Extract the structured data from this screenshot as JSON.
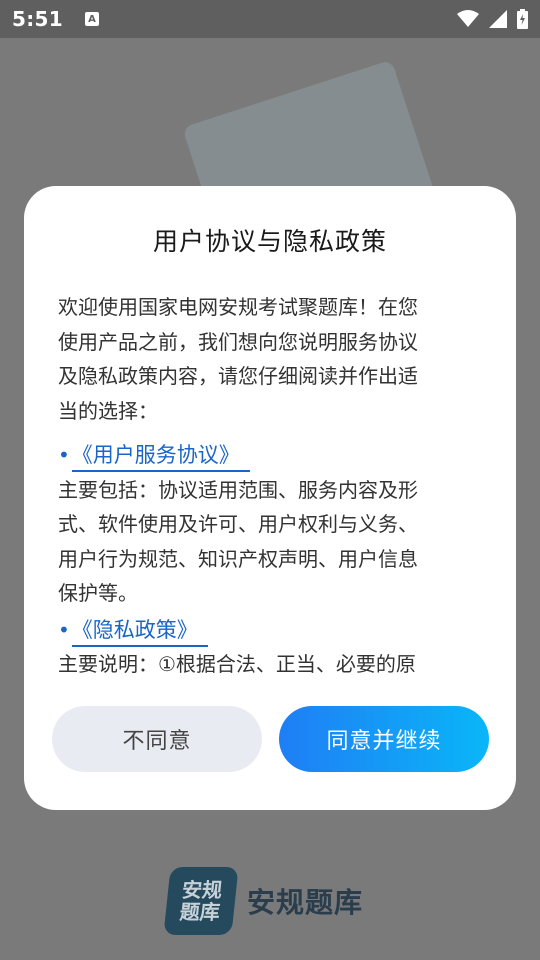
{
  "status_bar": {
    "time": "5:51",
    "notification_icon": "a-icon",
    "icons": [
      "wifi-icon",
      "cell-signal-icon",
      "battery-icon"
    ]
  },
  "dialog": {
    "title": "用户协议与隐私政策",
    "intro": [
      "欢迎使用国家电网安规考试聚题库！在您",
      "使用产品之前，我们想向您说明服务协议",
      "及隐私政策内容，请您仔细阅读并作出适",
      "当的选择："
    ],
    "links": [
      {
        "bullet": "•",
        "label": "《用户服务协议》",
        "description": [
          "主要包括：协议适用范围、服务内容及形",
          "式、软件使用及许可、用户权利与义务、",
          "用户行为规范、知识产权声明、用户信息",
          "保护等。"
        ]
      },
      {
        "bullet": "•",
        "label": "《隐私政策》",
        "description": [
          "主要说明：①根据合法、正当、必要的原"
        ]
      }
    ],
    "disagree_label": "不同意",
    "agree_label": "同意并继续"
  },
  "logo": {
    "icon_text_line1": "安规",
    "icon_text_line2": "题库",
    "app_name": "安规题库"
  },
  "colors": {
    "link": "#1a66c8",
    "agree_gradient_start": "#1f7ef5",
    "agree_gradient_end": "#0ab6f8",
    "disagree_bg": "#e9ebf2"
  }
}
